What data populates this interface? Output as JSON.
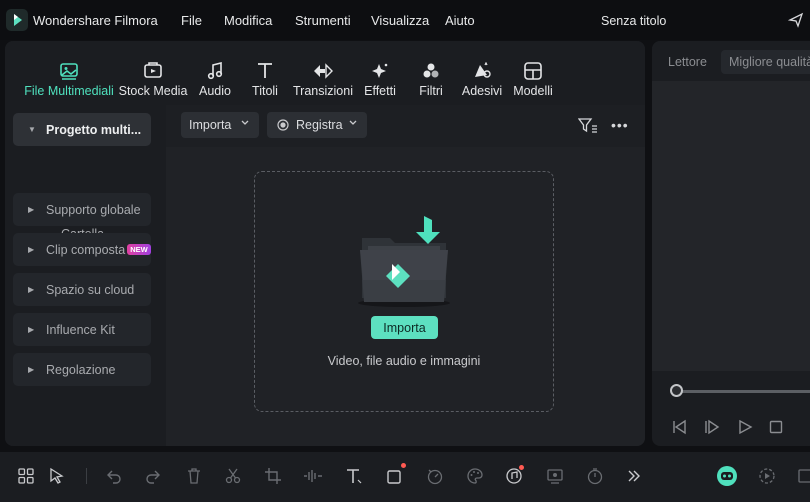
{
  "titlebar": {
    "app_name": "Wondershare Filmora",
    "menus": [
      "File",
      "Modifica",
      "Strumenti",
      "Visualizza",
      "Aiuto"
    ],
    "doc_title": "Senza titolo"
  },
  "tabs": [
    {
      "label": "File Multimediali",
      "icon": "media-icon",
      "active": true
    },
    {
      "label": "Stock Media",
      "icon": "stock-media-icon"
    },
    {
      "label": "Audio",
      "icon": "music-note-icon"
    },
    {
      "label": "Titoli",
      "icon": "title-text-icon"
    },
    {
      "label": "Transizioni",
      "icon": "transition-arrows-icon"
    },
    {
      "label": "Effetti",
      "icon": "sparkle-effects-icon"
    },
    {
      "label": "Filtri",
      "icon": "filter-circles-icon"
    },
    {
      "label": "Adesivi",
      "icon": "sticker-icon"
    },
    {
      "label": "Modelli",
      "icon": "templates-grid-icon"
    }
  ],
  "sidebar": {
    "items": [
      {
        "label": "Progetto multi...",
        "active": true
      },
      {
        "label": "Supporto globale"
      },
      {
        "label": "Clip composta",
        "badge": "NEW"
      },
      {
        "label": "Spazio su cloud"
      },
      {
        "label": "Influence Kit"
      },
      {
        "label": "Regolazione"
      }
    ],
    "sub_item": "Cartella"
  },
  "toolbar": {
    "import_label": "Importa",
    "record_label": "Registra"
  },
  "drop_zone": {
    "button_label": "Importa",
    "hint": "Video, file audio e immagini"
  },
  "player": {
    "label": "Lettore",
    "quality": "Migliore qualità"
  },
  "colors": {
    "accent": "#4fe0bd",
    "button": "#5de0c0",
    "background": "#0f1013",
    "panel": "#1b1d21"
  }
}
